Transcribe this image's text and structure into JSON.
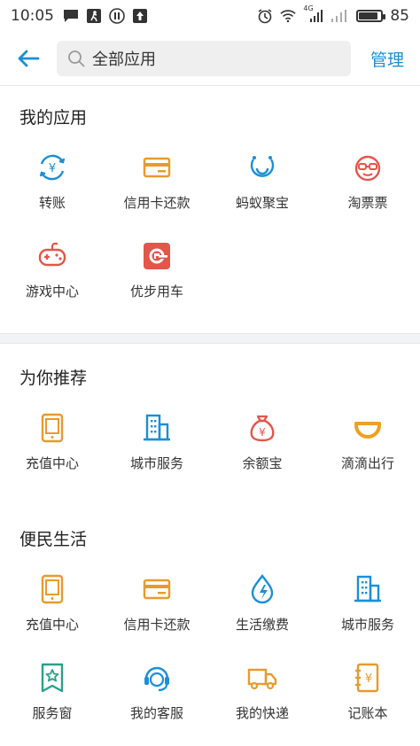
{
  "status_bar": {
    "time": "10:05",
    "battery": "85",
    "battery_level": 0.85,
    "network_label": "4G"
  },
  "header": {
    "search_text": "全部应用",
    "manage_label": "管理"
  },
  "colors": {
    "accent_blue": "#1a8fd6",
    "orange": "#e89a2c",
    "red": "#e4554a",
    "teal": "#2aa08a"
  },
  "sections": {
    "my_apps": {
      "title": "我的应用",
      "items": [
        {
          "label": "转账",
          "icon": "transfer-icon"
        },
        {
          "label": "信用卡还款",
          "icon": "credit-card-icon"
        },
        {
          "label": "蚂蚁聚宝",
          "icon": "ant-fortune-icon"
        },
        {
          "label": "淘票票",
          "icon": "taopiaopiao-icon"
        },
        {
          "label": "游戏中心",
          "icon": "gamepad-icon"
        },
        {
          "label": "优步用车",
          "icon": "uber-icon"
        }
      ]
    },
    "recommended": {
      "title": "为你推荐",
      "items": [
        {
          "label": "充值中心",
          "icon": "phone-icon"
        },
        {
          "label": "城市服务",
          "icon": "building-icon"
        },
        {
          "label": "余额宝",
          "icon": "money-bag-icon"
        },
        {
          "label": "滴滴出行",
          "icon": "didi-icon"
        }
      ]
    },
    "convenience": {
      "title": "便民生活",
      "items": [
        {
          "label": "充值中心",
          "icon": "phone-icon"
        },
        {
          "label": "信用卡还款",
          "icon": "credit-card-icon"
        },
        {
          "label": "生活缴费",
          "icon": "utility-drop-icon"
        },
        {
          "label": "城市服务",
          "icon": "building-icon"
        },
        {
          "label": "服务窗",
          "icon": "service-window-icon"
        },
        {
          "label": "我的客服",
          "icon": "customer-service-icon"
        },
        {
          "label": "我的快递",
          "icon": "delivery-truck-icon"
        },
        {
          "label": "记账本",
          "icon": "account-book-icon"
        }
      ]
    }
  }
}
